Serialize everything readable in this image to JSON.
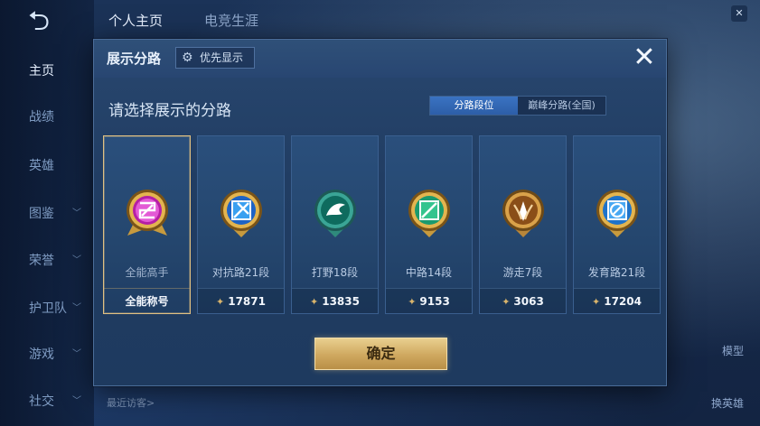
{
  "background": {
    "nav": [
      {
        "label": "主页",
        "active": true,
        "chevron": false
      },
      {
        "label": "战绩",
        "active": false,
        "chevron": false
      },
      {
        "label": "英雄",
        "active": false,
        "chevron": false
      },
      {
        "label": "图鉴",
        "active": false,
        "chevron": true
      },
      {
        "label": "荣誉",
        "active": false,
        "chevron": true
      },
      {
        "label": "护卫队",
        "active": false,
        "chevron": true
      },
      {
        "label": "游戏",
        "active": false,
        "chevron": true
      },
      {
        "label": "社交",
        "active": false,
        "chevron": true
      }
    ],
    "tabs": [
      "个人主页",
      "电竞生涯"
    ],
    "recent_visitors": "最近访客>",
    "right_labels": {
      "model": "模型",
      "swap_hero": "换英雄"
    }
  },
  "dialog": {
    "title": "展示分路",
    "priority_button": "优先显示",
    "prompt": "请选择展示的分路",
    "segments": [
      "分路段位",
      "巅峰分路(全国)"
    ],
    "active_segment": 0,
    "cards": [
      {
        "name": "全能高手",
        "value": "全能称号",
        "emblem": "all-round-emblem-icon",
        "selected": true,
        "show_points_icon": false
      },
      {
        "name": "对抗路21段",
        "value": "17871",
        "emblem": "clash-lane-emblem-icon",
        "selected": false,
        "show_points_icon": true
      },
      {
        "name": "打野18段",
        "value": "13835",
        "emblem": "jungle-emblem-icon",
        "selected": false,
        "show_points_icon": true
      },
      {
        "name": "中路14段",
        "value": "9153",
        "emblem": "mid-lane-emblem-icon",
        "selected": false,
        "show_points_icon": true
      },
      {
        "name": "游走7段",
        "value": "3063",
        "emblem": "roam-emblem-icon",
        "selected": false,
        "show_points_icon": true
      },
      {
        "name": "发育路21段",
        "value": "17204",
        "emblem": "farm-lane-emblem-icon",
        "selected": false,
        "show_points_icon": true
      }
    ],
    "confirm": "确定"
  },
  "colors": {
    "accent_gold": "#e0c082",
    "segment_active": "#3a73c2",
    "dialog_bg": "#213d63"
  }
}
